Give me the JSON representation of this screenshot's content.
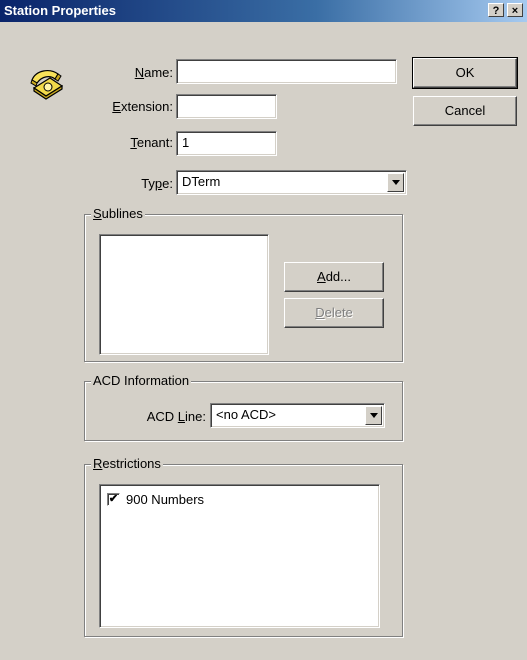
{
  "window": {
    "title": "Station Properties",
    "help_label": "?",
    "close_label": "×"
  },
  "fields": {
    "name": {
      "label_u": "N",
      "label_rest": "ame:",
      "value": ""
    },
    "extension": {
      "label_u": "E",
      "label_rest": "xtension:",
      "value": ""
    },
    "tenant": {
      "label_u": "T",
      "label_rest": "enant:",
      "value": "1"
    },
    "type": {
      "label_pre": "Ty",
      "label_u": "p",
      "label_rest": "e:",
      "value": "DTerm"
    }
  },
  "buttons": {
    "ok": "OK",
    "cancel": "Cancel"
  },
  "sublines": {
    "legend_u": "S",
    "legend_rest": "ublines",
    "items": [],
    "add_u": "A",
    "add_rest": "dd...",
    "delete_u": "D",
    "delete_rest": "elete"
  },
  "acd": {
    "legend": "ACD Information",
    "line_label_pre": "ACD ",
    "line_label_u": "L",
    "line_label_rest": "ine:",
    "line_value": "<no ACD>"
  },
  "restrictions": {
    "legend_u": "R",
    "legend_rest": "estrictions",
    "items": [
      {
        "label": "900 Numbers",
        "checked": true
      }
    ]
  },
  "icons": {
    "phone": "telephone-icon",
    "check_mark": "✔"
  }
}
